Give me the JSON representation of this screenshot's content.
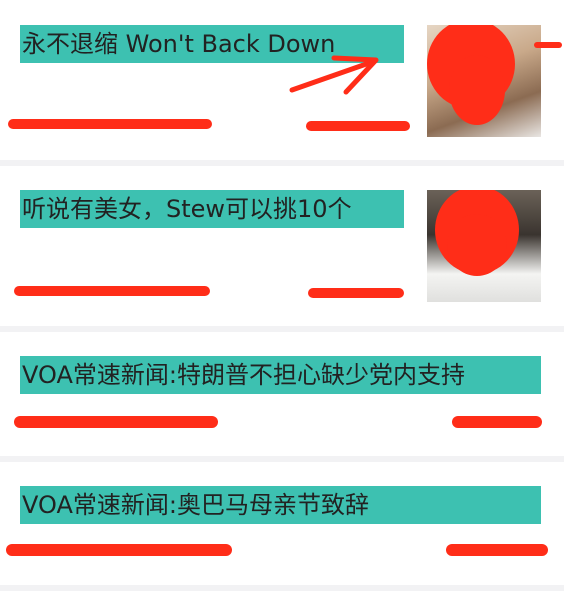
{
  "feed": {
    "items": [
      {
        "title": "永不退缩 Won't Back Down",
        "has_thumbnail": true
      },
      {
        "title": "听说有美女，Stew可以挑10个",
        "has_thumbnail": true
      },
      {
        "title": "VOA常速新闻:特朗普不担心缺少党内支持",
        "has_thumbnail": false
      },
      {
        "title": "VOA常速新闻:奥巴马母亲节致辞",
        "has_thumbnail": false
      }
    ]
  },
  "colors": {
    "title_highlight": "#3dc1b1",
    "redaction": "#ff2d18",
    "background": "#f2f2f4",
    "card": "#ffffff"
  },
  "icons": [
    "arrow-annotation-icon"
  ]
}
